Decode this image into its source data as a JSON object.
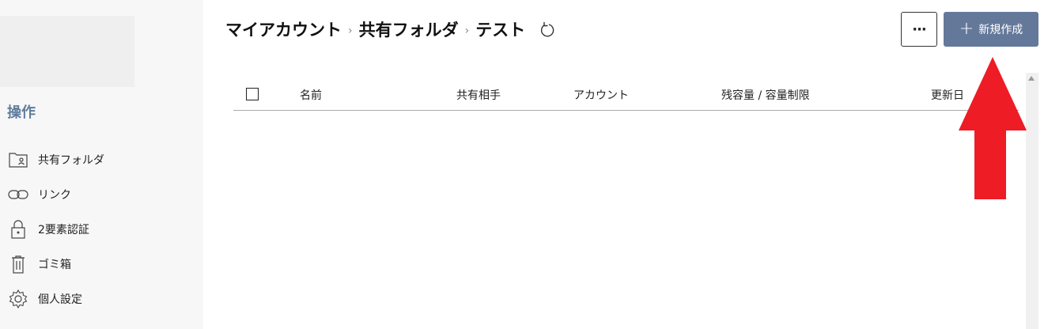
{
  "sidebar": {
    "section_title": "操作",
    "items": [
      {
        "label": "共有フォルダ",
        "icon": "shared-folder-icon"
      },
      {
        "label": "リンク",
        "icon": "link-icon"
      },
      {
        "label": "2要素認証",
        "icon": "lock-icon"
      },
      {
        "label": "ゴミ箱",
        "icon": "trash-icon"
      },
      {
        "label": "個人設定",
        "icon": "gear-icon"
      }
    ]
  },
  "breadcrumb": {
    "items": [
      "マイアカウント",
      "共有フォルダ",
      "テスト"
    ],
    "separator": "›"
  },
  "toolbar": {
    "more_label": "···",
    "new_label": "新規作成",
    "new_icon": "+",
    "new_button_color": "#64799a"
  },
  "table": {
    "columns": [
      "名前",
      "共有相手",
      "アカウント",
      "残容量 / 容量制限",
      "更新日"
    ]
  },
  "annotation": {
    "color": "#ee1c25",
    "icon": "red-arrow-up"
  }
}
